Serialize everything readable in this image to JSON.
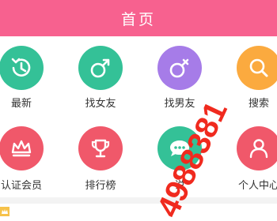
{
  "header": {
    "title": "首页"
  },
  "grid": [
    {
      "label": "最新",
      "icon": "history-icon",
      "color": "#34c197"
    },
    {
      "label": "找女友",
      "icon": "male-icon",
      "color": "#34c197"
    },
    {
      "label": "找男友",
      "icon": "female-icon",
      "color": "#a67ce8"
    },
    {
      "label": "搜索",
      "icon": "search-icon",
      "color": "#fbaa3f"
    },
    {
      "label": "认证会员",
      "icon": "crown-icon",
      "color": "#f0586a"
    },
    {
      "label": "排行榜",
      "icon": "trophy-icon",
      "color": "#f0586a"
    },
    {
      "label": "说",
      "icon": "chat-icon",
      "color": "#34c197"
    },
    {
      "label": "个人中心",
      "icon": "person-icon",
      "color": "#f0586a"
    }
  ],
  "watermark": {
    "text": "4988381",
    "color": "#f02a1e"
  }
}
